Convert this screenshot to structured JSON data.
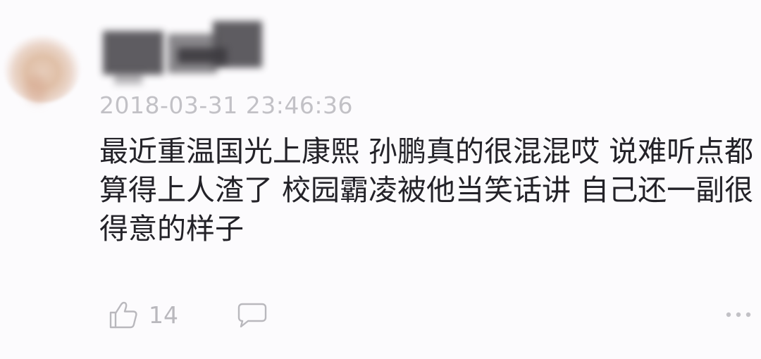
{
  "comment": {
    "username_obscured": true,
    "timestamp": "2018-03-31 23:46:36",
    "text": "最近重温国光上康熙 孙鹏真的很混混哎 说难听点都算得上人渣了 校园霸凌被他当笑话讲 自己还一副很得意的样子",
    "likes": "14",
    "icons": {
      "like": "thumbs-up-icon",
      "reply": "comment-icon",
      "more": "more-dots-icon"
    },
    "colors": {
      "background": "#fcfbfd",
      "text": "#232228",
      "meta": "#c2c1c6",
      "icon": "#b9b8bd"
    }
  }
}
